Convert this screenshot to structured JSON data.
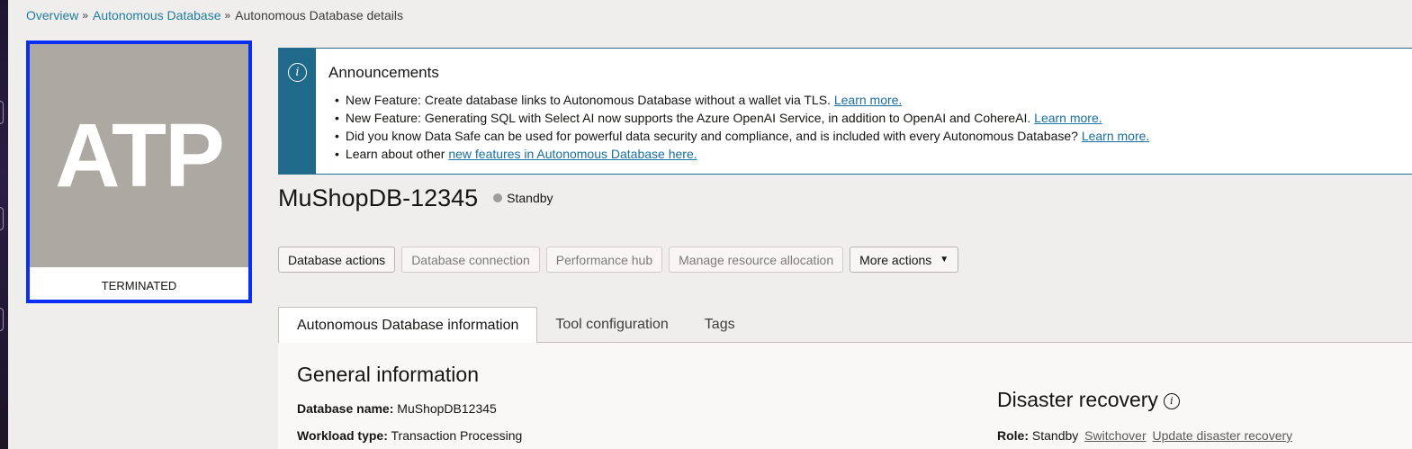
{
  "breadcrumb": {
    "items": [
      {
        "label": "Overview"
      },
      {
        "label": "Autonomous Database"
      },
      {
        "label": "Autonomous Database details"
      }
    ],
    "separator": "»"
  },
  "db_tile": {
    "badge": "ATP",
    "state": "TERMINATED"
  },
  "announcements": {
    "title": "Announcements",
    "icon": "info-icon",
    "items": [
      {
        "text": "New Feature: Create database links to Autonomous Database without a wallet via TLS.",
        "link": "Learn more."
      },
      {
        "text": "New Feature: Generating SQL with Select AI now supports the Azure OpenAI Service, in addition to OpenAI and CohereAI.",
        "link": "Learn more."
      },
      {
        "text": "Did you know Data Safe can be used for powerful data security and compliance, and is included with every Autonomous Database?",
        "link": "Learn more."
      },
      {
        "text": "Learn about other",
        "link": "new features in Autonomous Database here."
      }
    ]
  },
  "database": {
    "name": "MuShopDB-12345",
    "status": "Standby"
  },
  "actions": {
    "database_actions": "Database actions",
    "database_connection": "Database connection",
    "performance_hub": "Performance hub",
    "manage_resource_allocation": "Manage resource allocation",
    "more_actions": "More actions",
    "caret": "▼"
  },
  "tabs": [
    {
      "label": "Autonomous Database information"
    },
    {
      "label": "Tool configuration"
    },
    {
      "label": "Tags"
    }
  ],
  "general_info": {
    "title": "General information",
    "database_name_label": "Database name:",
    "database_name_value": "MuShopDB12345",
    "workload_type_label": "Workload type:",
    "workload_type_value": "Transaction Processing"
  },
  "disaster_recovery": {
    "title": "Disaster recovery",
    "role_label": "Role:",
    "role_value": "Standby",
    "switchover_link": "Switchover",
    "update_link": "Update disaster recovery"
  },
  "colors": {
    "accent_blue": "#0a2ff2",
    "announce_bar": "#1f6a8a",
    "link": "#227e9e",
    "tile_grey": "#aca8a2"
  }
}
